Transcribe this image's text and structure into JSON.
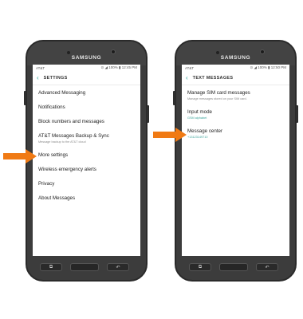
{
  "brand": "SAMSUNG",
  "colors": {
    "arrow": "#f07a14",
    "accent": "#2aa89a"
  },
  "left_phone": {
    "status": {
      "carrier": "AT&T",
      "right": "⊙ ◢ 100% ▮ 12:45 PM"
    },
    "title": "SETTINGS",
    "items": [
      {
        "label": "Advanced Messaging"
      },
      {
        "label": "Notifications"
      },
      {
        "label": "Block numbers and messages"
      },
      {
        "label": "AT&T Messages Backup & Sync",
        "sub": "Message backup to the AT&T cloud"
      },
      {
        "label": "More settings"
      },
      {
        "label": "Wireless emergency alerts"
      },
      {
        "label": "Privacy"
      },
      {
        "label": "About Messages"
      }
    ]
  },
  "right_phone": {
    "status": {
      "carrier": "AT&T",
      "right": "⊙ ◢ 100% ▮ 12:50 PM"
    },
    "title": "TEXT MESSAGES",
    "items": [
      {
        "label": "Manage SIM card messages",
        "sub": "Manage messages stored on your SIM card."
      },
      {
        "label": "Input mode",
        "sub": "GSM alphabet"
      },
      {
        "label": "Message center",
        "sub": "+13123149710"
      }
    ]
  },
  "icons": {
    "back": "back-arrow-icon",
    "recent": "recent-apps-icon",
    "home": "home-button",
    "nav_back": "nav-back-icon"
  }
}
